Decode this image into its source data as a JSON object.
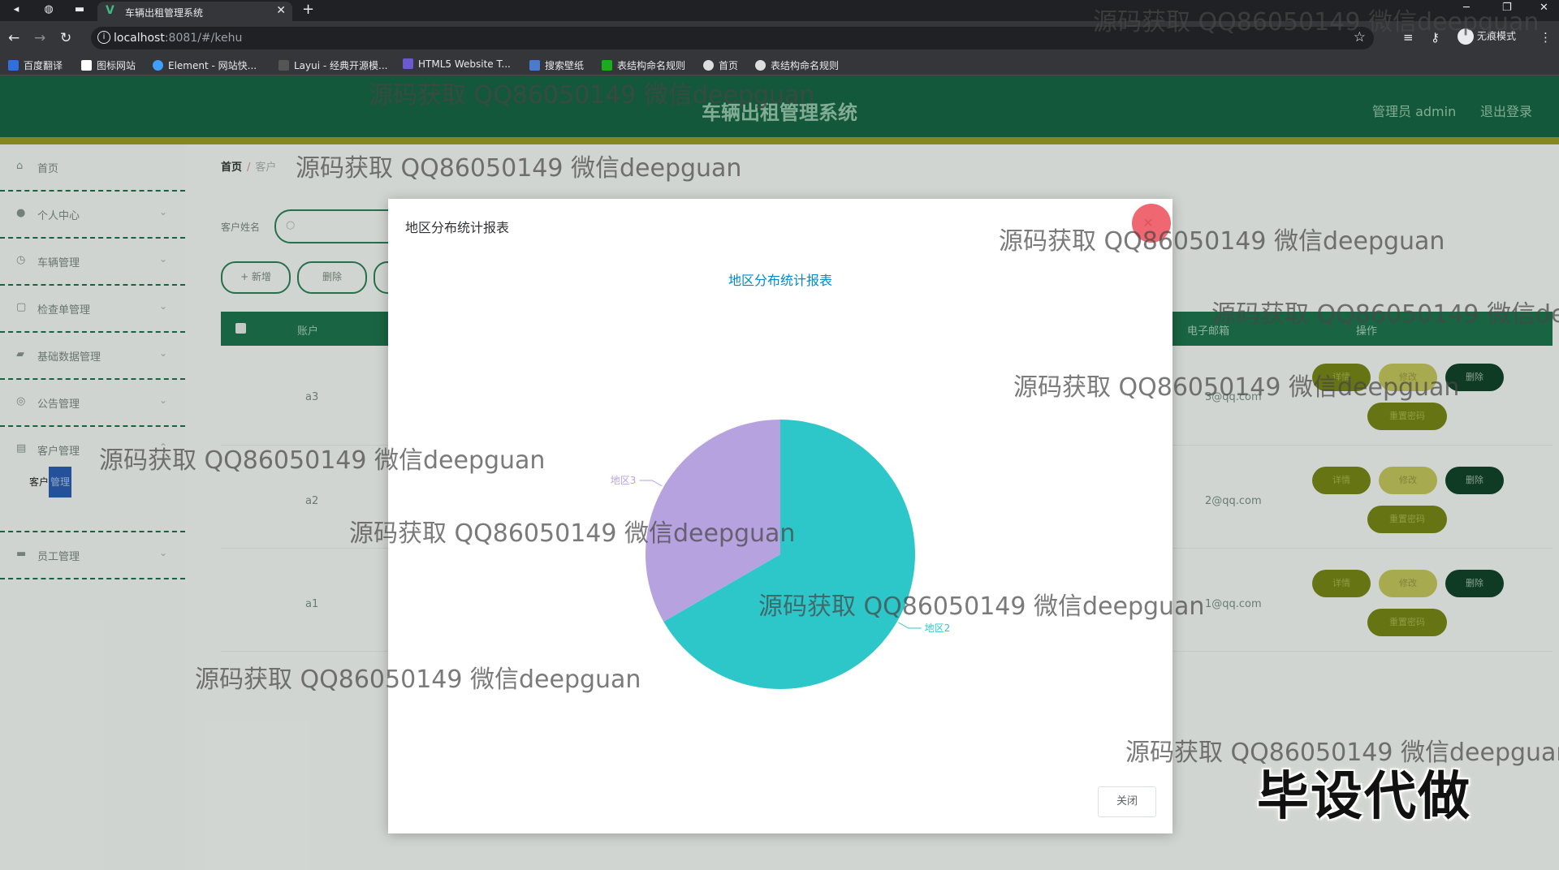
{
  "browser": {
    "tab_title": "车辆出租管理系统",
    "tab_favicon": "vue-logo-icon",
    "url_host": "localhost",
    "url_rest": ":8081/#/kehu",
    "profile_label": "无痕模式",
    "bookmarks": [
      "百度翻译",
      "图标网站",
      "Element - 网站快...",
      "Layui - 经典开源模...",
      "HTML5 Website T...",
      "搜索壁纸",
      "表结构命名规则",
      "首页",
      "表结构命名规则"
    ]
  },
  "app": {
    "title": "车辆出租管理系统",
    "user_label": "管理员 admin",
    "logout_label": "退出登录",
    "colors": {
      "header": "#155e3e",
      "accent_bar": "#8a9127",
      "table_header": "#1b6b47"
    }
  },
  "sidebar": {
    "items": [
      {
        "label": "首页",
        "icon": "home-icon"
      },
      {
        "label": "个人中心",
        "icon": "user-icon"
      },
      {
        "label": "车辆管理",
        "icon": "car-icon"
      },
      {
        "label": "检查单管理",
        "icon": "clipboard-icon"
      },
      {
        "label": "基础数据管理",
        "icon": "database-icon"
      },
      {
        "label": "公告管理",
        "icon": "notice-icon"
      },
      {
        "label": "客户管理",
        "icon": "customer-icon"
      },
      {
        "label": "员工管理",
        "icon": "staff-icon"
      }
    ],
    "sub_item_prefix": "客户",
    "sub_item_highlight": "管理"
  },
  "main": {
    "breadcrumb_home": "首页",
    "breadcrumb_current": "客户",
    "search_label": "客户姓名",
    "add_button": "+ 新增",
    "delete_button": "删除",
    "table_headers": {
      "account": "账户",
      "email": "电子邮箱",
      "ops": "操作"
    },
    "rows": [
      {
        "account": "a3",
        "email": "3@qq.com"
      },
      {
        "account": "a2",
        "email": "2@qq.com"
      },
      {
        "account": "a1",
        "email": "1@qq.com"
      }
    ],
    "row_actions": {
      "detail": "详情",
      "edit": "修改",
      "delete": "删除",
      "reset": "重置密码"
    }
  },
  "dialog": {
    "title": "地区分布统计报表",
    "close_button": "关闭"
  },
  "chart_data": {
    "type": "pie",
    "title": "地区分布统计报表",
    "slices": [
      {
        "label": "地区2",
        "value": 2,
        "color": "#2ec7c9"
      },
      {
        "label": "地区3",
        "value": 1,
        "color": "#b6a2de"
      }
    ]
  },
  "watermarks": {
    "text": "源码获取 QQ86050149 微信deepguan",
    "big_text": "毕设代做"
  }
}
